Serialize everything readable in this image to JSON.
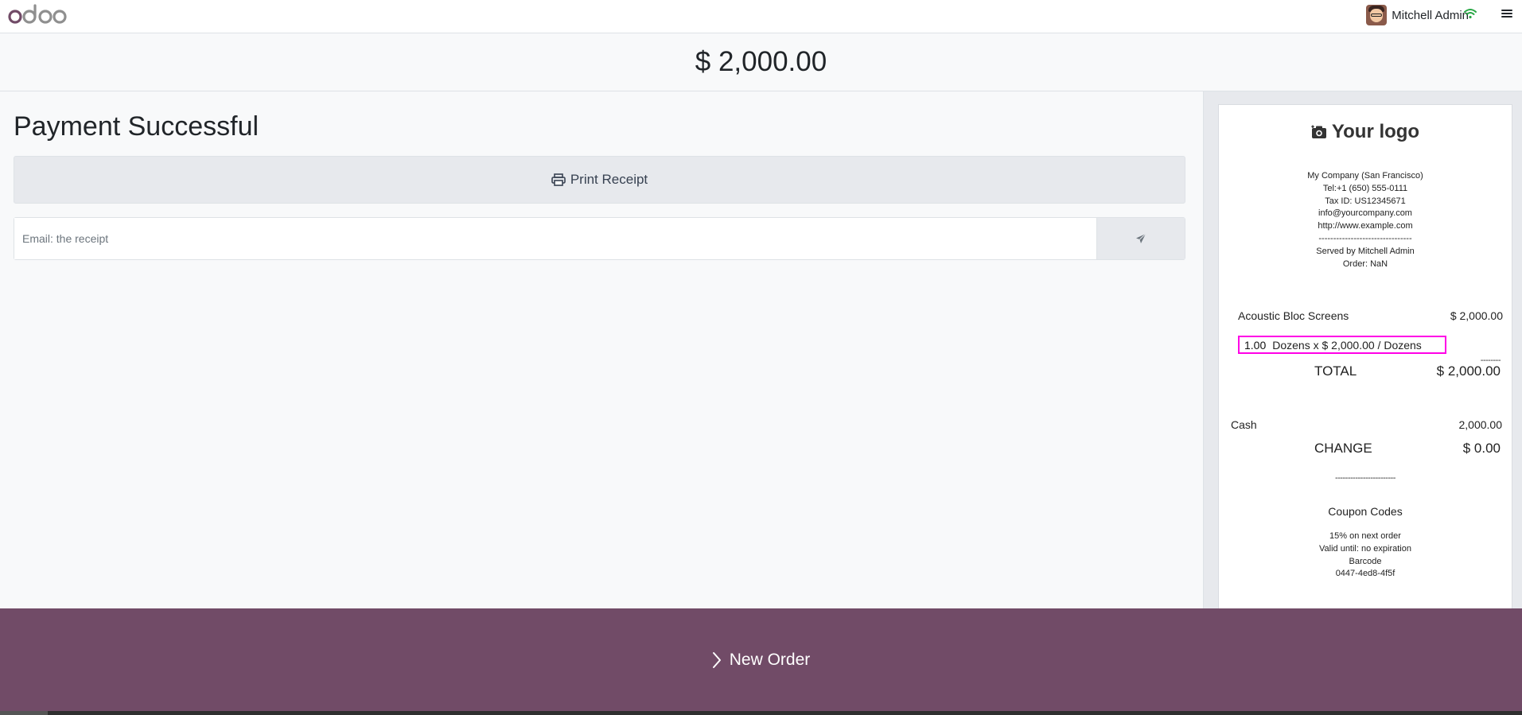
{
  "navbar": {
    "user_name": "Mitchell Admin"
  },
  "amount_header": "$ 2,000.00",
  "main": {
    "title": "Payment Successful",
    "print_button_label": "Print Receipt",
    "email_placeholder": "Email: the receipt"
  },
  "receipt": {
    "logo_text": "Your logo",
    "company_lines": [
      "My Company (San Francisco)",
      "Tel:+1 (650) 555-0111",
      "Tax ID: US12345671",
      "info@yourcompany.com",
      "http://www.example.com",
      "--------------------------------",
      "Served by Mitchell Admin",
      "Order: NaN"
    ],
    "orderline": {
      "product": "Acoustic Bloc Screens",
      "price": "$ 2,000.00",
      "qty": "1.00",
      "detail": "Dozens x $ 2,000.00 / Dozens"
    },
    "small_separator": "--------",
    "total_label": "TOTAL",
    "total_value": "$ 2,000.00",
    "payment_method": "Cash",
    "payment_amount": "2,000.00",
    "change_label": "CHANGE",
    "change_value": "$ 0.00",
    "separator": "------------------------",
    "coupon_title": "Coupon Codes",
    "coupon_lines": [
      "15% on next order",
      "Valid until: no expiration",
      "Barcode",
      "0447-4ed8-4f5f"
    ]
  },
  "bottom": {
    "new_order_label": "New Order"
  },
  "colors": {
    "brand_purple": "#714b67",
    "highlight": "#ff00e6",
    "wifi_green": "#28a745"
  }
}
